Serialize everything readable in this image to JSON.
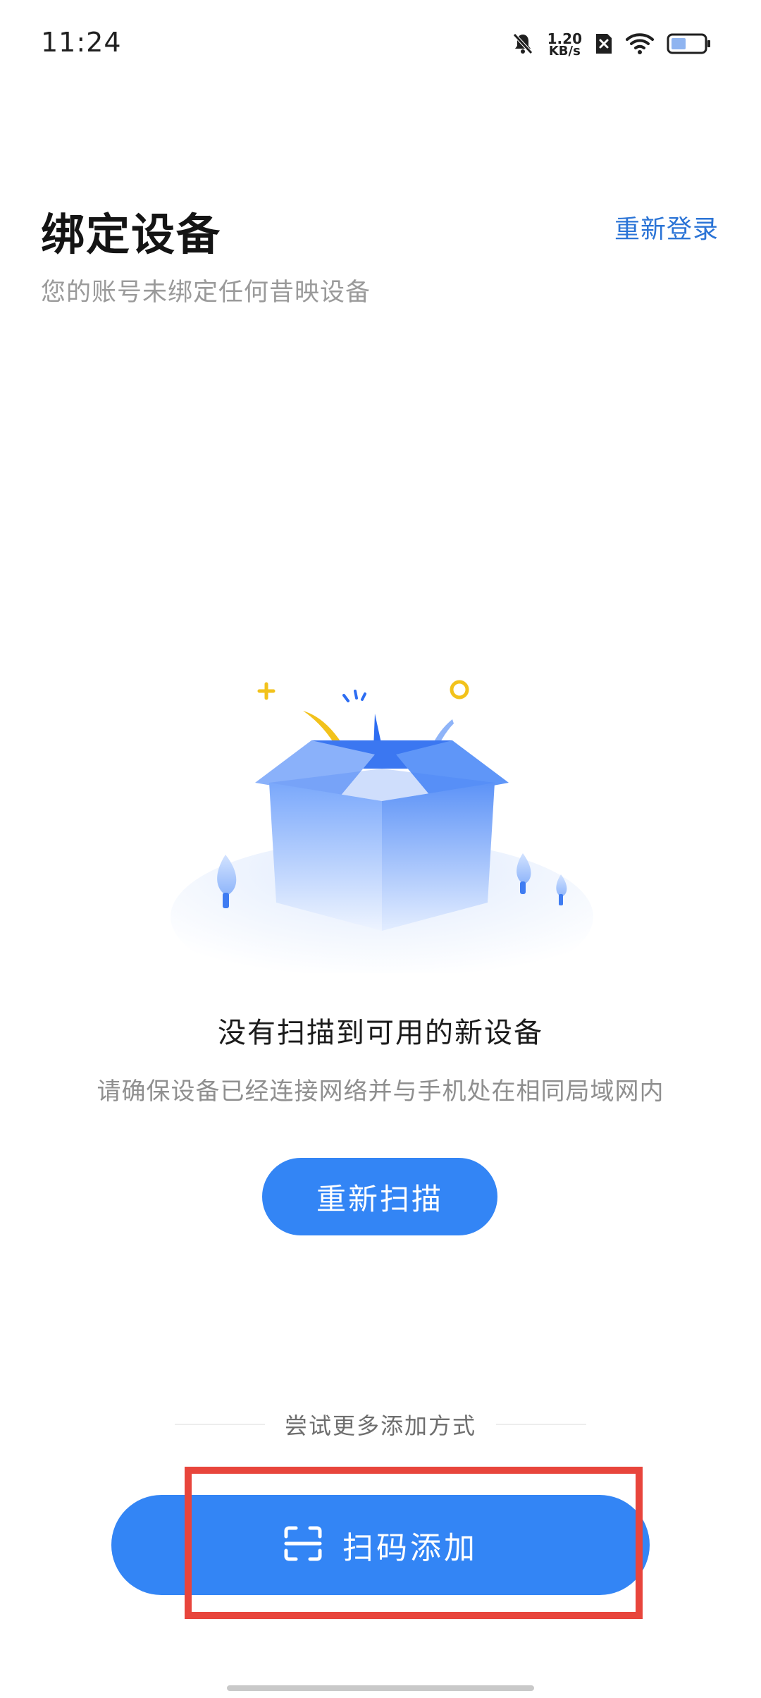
{
  "status_bar": {
    "time": "11:24",
    "net_speed_value": "1.20",
    "net_speed_unit": "KB/s",
    "icons": [
      "mute-bell-icon",
      "sim-off-icon",
      "wifi-icon",
      "battery-icon"
    ]
  },
  "header": {
    "title": "绑定设备",
    "relogin_label": "重新登录",
    "subtitle": "您的账号未绑定任何昔映设备"
  },
  "empty_state": {
    "illustration": "open-box-illustration",
    "title": "没有扫描到可用的新设备",
    "description": "请确保设备已经连接网络并与手机处在相同局域网内",
    "rescan_label": "重新扫描"
  },
  "more_methods": {
    "divider_label": "尝试更多添加方式",
    "scan_add_label": "扫码添加",
    "scan_icon": "scan-frame-icon"
  },
  "colors": {
    "accent": "#3385f5",
    "link": "#2b74d6",
    "highlight": "#e8453c"
  }
}
